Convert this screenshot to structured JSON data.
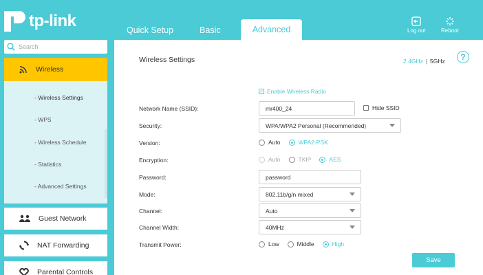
{
  "brand": {
    "logo_text": "tp-link"
  },
  "nav": {
    "tabs": [
      {
        "label": "Quick Setup"
      },
      {
        "label": "Basic"
      },
      {
        "label": "Advanced"
      }
    ],
    "logout_label": "Log out",
    "reboot_label": "Reboot"
  },
  "sidebar": {
    "search_placeholder": "Search",
    "active_item": "Wireless",
    "submenu": [
      "- Wireless Settings",
      "- WPS",
      "- Wireless Schedule",
      "- Statistics",
      "- Advanced Settings"
    ],
    "items": [
      {
        "label": "Guest Network",
        "icon": "guest-network-icon"
      },
      {
        "label": "NAT Forwarding",
        "icon": "nat-forwarding-icon"
      },
      {
        "label": "Parental Controls",
        "icon": "heart-icon"
      }
    ]
  },
  "panel": {
    "title": "Wireless Settings",
    "band_24": "2.4GHz",
    "band_sep": "|",
    "band_5": "5GHz",
    "help_glyph": "?",
    "enable_label": "Enable Wireless Radio",
    "labels": {
      "ssid": "Network Name (SSID):",
      "security": "Security:",
      "version": "Version:",
      "encryption": "Encryption:",
      "password": "Password:",
      "mode": "Mode:",
      "channel": "Channel:",
      "channel_width": "Channel Width:",
      "transmit_power": "Transmit Power:"
    },
    "ssid_value": "mr400_24",
    "hide_ssid_label": "Hide SSID",
    "security_value": "WPA/WPA2 Personal (Recommended)",
    "version_options": [
      "Auto",
      "WPA2-PSK"
    ],
    "encryption_options": [
      "Auto",
      "TKIP",
      "AES"
    ],
    "password_value": "password",
    "mode_value": "802.11b/g/n mixed",
    "channel_value": "Auto",
    "channel_width_value": "40MHz",
    "power_options": [
      "Low",
      "Middle",
      "High"
    ],
    "save_label": "Save"
  },
  "colors": {
    "accent": "#4acbd6",
    "active_menu": "#ffc600"
  }
}
